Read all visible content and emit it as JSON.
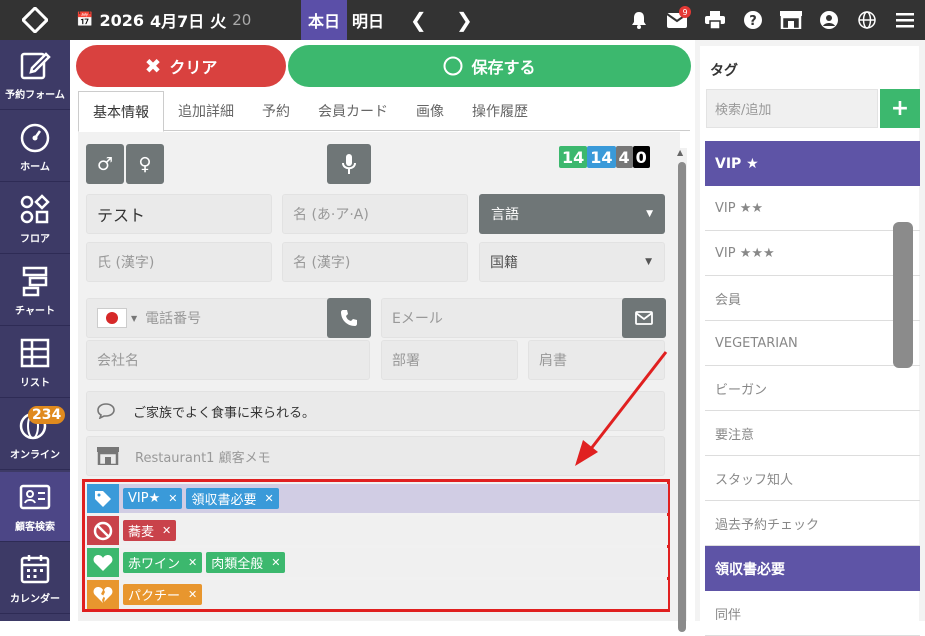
{
  "topbar": {
    "date_year": "2026",
    "date_day": "4月7日",
    "weekday": "火",
    "week_num": "20",
    "today_label": "本日",
    "tomorrow_label": "明日",
    "notif_count": "9",
    "icons": [
      "bell-icon",
      "mail-icon",
      "print-icon",
      "help-icon",
      "store-icon",
      "user-icon",
      "globe-icon",
      "menu-icon"
    ]
  },
  "sidebar": {
    "items": [
      {
        "label": "予約フォーム",
        "icon": "pen-icon"
      },
      {
        "label": "ホーム",
        "icon": "gauge-icon"
      },
      {
        "label": "フロア",
        "icon": "shapes-icon"
      },
      {
        "label": "チャート",
        "icon": "chart-icon"
      },
      {
        "label": "リスト",
        "icon": "table-icon"
      },
      {
        "label": "オンライン",
        "icon": "globe-icon",
        "badge": "234"
      },
      {
        "label": "顧客検索",
        "icon": "id-card-icon"
      },
      {
        "label": "カレンダー",
        "icon": "calendar-icon"
      }
    ]
  },
  "actions": {
    "clear_label": "クリア",
    "save_label": "保存する"
  },
  "tabs": [
    "基本情報",
    "追加詳細",
    "予約",
    "会員カード",
    "画像",
    "操作履歴"
  ],
  "form": {
    "counts": [
      "14",
      "14",
      "4",
      "0"
    ],
    "counter_colors": [
      "#3cb86e",
      "#3a9ad9",
      "#777777",
      "#000000"
    ],
    "last_name": "テスト",
    "first_name_kana_placeholder": "名 (あ·ア·A)",
    "language_label": "言語",
    "last_name_kanji_placeholder": "氏 (漢字)",
    "first_name_kanji_placeholder": "名 (漢字)",
    "nationality_placeholder": "国籍",
    "phone_placeholder": "電話番号",
    "email_placeholder": "Eメール",
    "company_placeholder": "会社名",
    "department_placeholder": "部署",
    "title_placeholder": "肩書",
    "note": "ご家族でよく食事に来られる。",
    "restaurant_memo_placeholder": "Restaurant1 顧客メモ"
  },
  "tag_rows": [
    {
      "icon": "tag-icon",
      "color": "#3a9ad9",
      "bg": "#d1cde4",
      "chips": [
        {
          "label": "VIP★",
          "color": "#3a9ad9"
        },
        {
          "label": "領収書必要",
          "color": "#3a9ad9"
        }
      ]
    },
    {
      "icon": "ban-icon",
      "color": "#c9424a",
      "bg": "#f0f0f0",
      "chips": [
        {
          "label": "蕎麦",
          "color": "#c9424a"
        }
      ]
    },
    {
      "icon": "heart-icon",
      "color": "#3cb86e",
      "bg": "#f0f0f0",
      "chips": [
        {
          "label": "赤ワイン",
          "color": "#3cb86e"
        },
        {
          "label": "肉類全般",
          "color": "#3cb86e"
        }
      ]
    },
    {
      "icon": "broken-heart-icon",
      "color": "#e8962e",
      "bg": "#f0f0f0",
      "chips": [
        {
          "label": "パクチー",
          "color": "#e8962e"
        }
      ]
    }
  ],
  "right_panel": {
    "title": "タグ",
    "search_placeholder": "検索/追加",
    "add_label": "+",
    "items": [
      {
        "label": "VIP ★",
        "head": true
      },
      {
        "label": "VIP ★★",
        "head": false
      },
      {
        "label": "VIP ★★★",
        "head": false
      },
      {
        "label": "会員",
        "head": false
      },
      {
        "label": "VEGETARIAN",
        "head": false
      },
      {
        "label": "ビーガン",
        "head": false
      },
      {
        "label": "要注意",
        "head": false
      },
      {
        "label": "スタッフ知人",
        "head": false
      },
      {
        "label": "過去予約チェック",
        "head": false
      },
      {
        "label": "領収書必要",
        "head": true
      },
      {
        "label": "同伴",
        "head": false
      }
    ]
  },
  "colors": {
    "topbar": "#333333",
    "sidebar": "#3d3a66",
    "accent": "#5b4fa8",
    "clear": "#d9413f",
    "save": "#3cb86e",
    "highlight": "#e02020"
  }
}
